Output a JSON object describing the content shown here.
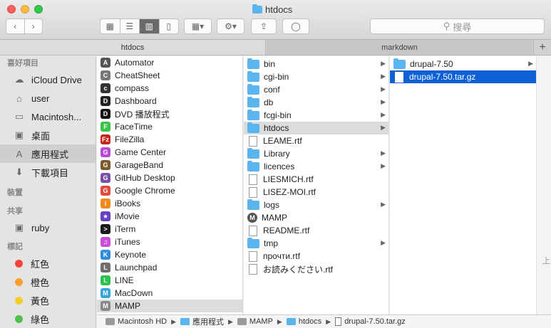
{
  "window": {
    "title": "htdocs"
  },
  "toolbar": {
    "search_placeholder": "搜尋",
    "back_icon": "chevron-left",
    "forward_icon": "chevron-right"
  },
  "tabs": [
    {
      "label": "htdocs",
      "active": true
    },
    {
      "label": "markdown",
      "active": false
    }
  ],
  "sidebar": {
    "favorites_header": "喜好項目",
    "favorites": [
      {
        "label": "iCloud Drive",
        "icon": "cloud-icon"
      },
      {
        "label": "user",
        "icon": "home-icon"
      },
      {
        "label": "Macintosh...",
        "icon": "disk-icon"
      },
      {
        "label": "桌面",
        "icon": "desktop-icon"
      },
      {
        "label": "應用程式",
        "icon": "apps-icon",
        "selected": true
      },
      {
        "label": "下載項目",
        "icon": "download-icon"
      }
    ],
    "devices_header": "裝置",
    "shared_header": "共享",
    "shared": [
      {
        "label": "ruby",
        "icon": "computer-icon"
      }
    ],
    "tags_header": "標記",
    "tags": [
      {
        "label": "紅色",
        "color": "#f6443b"
      },
      {
        "label": "橙色",
        "color": "#f99f2a"
      },
      {
        "label": "黃色",
        "color": "#f5cc2a"
      },
      {
        "label": "綠色",
        "color": "#4ec14b"
      }
    ]
  },
  "columns": {
    "apps": [
      {
        "label": "Automator",
        "color": "#555555",
        "glyph": "A"
      },
      {
        "label": "CheatSheet",
        "color": "#777777",
        "glyph": "C"
      },
      {
        "label": "compass",
        "color": "#333333",
        "glyph": "c"
      },
      {
        "label": "Dashboard",
        "color": "#222222",
        "glyph": "D"
      },
      {
        "label": "DVD 播放程式",
        "color": "#111111",
        "glyph": "D"
      },
      {
        "label": "FaceTime",
        "color": "#39c449",
        "glyph": "F"
      },
      {
        "label": "FileZilla",
        "color": "#c6251c",
        "glyph": "Fz"
      },
      {
        "label": "Game Center",
        "color": "#b84bd6",
        "glyph": "G"
      },
      {
        "label": "GarageBand",
        "color": "#7a5a2b",
        "glyph": "G"
      },
      {
        "label": "GitHub Desktop",
        "color": "#7b4fa8",
        "glyph": "G"
      },
      {
        "label": "Google Chrome",
        "color": "#e24a3a",
        "glyph": "G"
      },
      {
        "label": "iBooks",
        "color": "#f0891a",
        "glyph": "i"
      },
      {
        "label": "iMovie",
        "color": "#6a3fc4",
        "glyph": "★"
      },
      {
        "label": "iTerm",
        "color": "#1b1b1b",
        "glyph": ">"
      },
      {
        "label": "iTunes",
        "color": "#c94fd8",
        "glyph": "♫"
      },
      {
        "label": "Keynote",
        "color": "#2f8de0",
        "glyph": "K"
      },
      {
        "label": "Launchpad",
        "color": "#6e6e6e",
        "glyph": "L"
      },
      {
        "label": "LINE",
        "color": "#2ac24b",
        "glyph": "L"
      },
      {
        "label": "MacDown",
        "color": "#3aa6db",
        "glyph": "M"
      },
      {
        "label": "MAMP",
        "color": "#888888",
        "glyph": "M",
        "highlighted": true
      }
    ],
    "mamp": [
      {
        "label": "bin",
        "type": "folder",
        "has_children": true
      },
      {
        "label": "cgi-bin",
        "type": "folder",
        "has_children": true
      },
      {
        "label": "conf",
        "type": "folder",
        "has_children": true
      },
      {
        "label": "db",
        "type": "folder",
        "has_children": true
      },
      {
        "label": "fcgi-bin",
        "type": "folder",
        "has_children": true
      },
      {
        "label": "htdocs",
        "type": "folder",
        "has_children": true,
        "highlighted": true
      },
      {
        "label": "LEAME.rtf",
        "type": "doc",
        "has_children": false
      },
      {
        "label": "Library",
        "type": "folder",
        "has_children": true
      },
      {
        "label": "licences",
        "type": "folder",
        "has_children": true
      },
      {
        "label": "LIESMICH.rtf",
        "type": "doc",
        "has_children": false
      },
      {
        "label": "LISEZ-MOI.rtf",
        "type": "doc",
        "has_children": false
      },
      {
        "label": "logs",
        "type": "folder",
        "has_children": true
      },
      {
        "label": "MAMP",
        "type": "app",
        "has_children": false
      },
      {
        "label": "README.rtf",
        "type": "doc",
        "has_children": false
      },
      {
        "label": "tmp",
        "type": "folder",
        "has_children": true
      },
      {
        "label": "прочти.rtf",
        "type": "doc",
        "has_children": false
      },
      {
        "label": "お読みください.rtf",
        "type": "doc",
        "has_children": false
      }
    ],
    "htdocs": [
      {
        "label": "drupal-7.50",
        "type": "folder",
        "has_children": true
      },
      {
        "label": "drupal-7.50.tar.gz",
        "type": "doc",
        "has_children": false,
        "selected": true
      }
    ]
  },
  "pathbar": [
    {
      "label": "Macintosh HD",
      "icon": "disk"
    },
    {
      "label": "應用程式",
      "icon": "folder"
    },
    {
      "label": "MAMP",
      "icon": "disk"
    },
    {
      "label": "htdocs",
      "icon": "folder"
    },
    {
      "label": "drupal-7.50.tar.gz",
      "icon": "doc"
    }
  ],
  "scroll_hint": "上"
}
